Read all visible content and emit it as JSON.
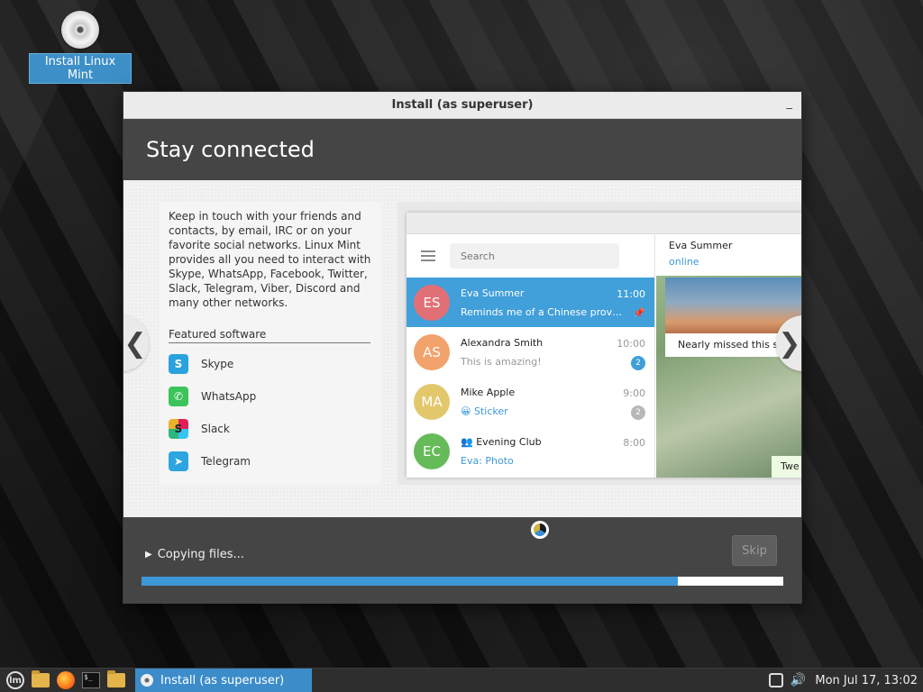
{
  "desktop": {
    "icon_label": "Install Linux Mint"
  },
  "window": {
    "title": "Install (as superuser)",
    "minimize_glyph": "_",
    "slide": {
      "heading": "Stay connected",
      "description": "Keep in touch with your friends and contacts, by email, IRC or on your favorite social networks. Linux Mint provides all you need to interact with Skype, WhatsApp, Facebook, Twitter, Slack, Telegram, Viber, Discord and many other networks.",
      "featured_label": "Featured software",
      "apps": [
        {
          "name": "Skype",
          "icon": "skype-icon",
          "glyph": "S"
        },
        {
          "name": "WhatsApp",
          "icon": "whatsapp-icon",
          "glyph": "✆"
        },
        {
          "name": "Slack",
          "icon": "slack-icon",
          "glyph": "S"
        },
        {
          "name": "Telegram",
          "icon": "telegram-icon",
          "glyph": "➤"
        }
      ],
      "prev_glyph": "❮",
      "next_glyph": "❯",
      "mockup": {
        "search_placeholder": "Search",
        "chats": [
          {
            "initials": "ES",
            "name": "Eva Summer",
            "time": "11:00",
            "message": "Reminds me of a Chinese prover…",
            "color": "#e17076",
            "active": true
          },
          {
            "initials": "AS",
            "name": "Alexandra Smith",
            "time": "10:00",
            "message": "This is amazing!",
            "color": "#f2a26b",
            "badge": "2"
          },
          {
            "initials": "MA",
            "name": "Mike Apple",
            "time": "9:00",
            "message": "😀 Sticker",
            "color": "#e3c86b",
            "badge": "2"
          },
          {
            "initials": "EC",
            "name": "👥 Evening Club",
            "time": "8:00",
            "message": "Eva: Photo",
            "color": "#65bb58"
          }
        ],
        "chat_header": {
          "name": "Eva Summer",
          "status": "online"
        },
        "photo_caption": "Nearly missed this s",
        "bubble_text": "Twe"
      }
    },
    "footer": {
      "status_text": "Copying files...",
      "skip_label": "Skip",
      "progress": 0.835
    }
  },
  "taskbar": {
    "task_label": "Install (as superuser)",
    "clock": "Mon Jul 17, 13:02",
    "menu_glyph": "lm",
    "terminal_glyph": "$_"
  },
  "colors": {
    "accent": "#3e97d7",
    "header_bg": "#454545",
    "taskbar_bg": "#2e2e2e"
  }
}
